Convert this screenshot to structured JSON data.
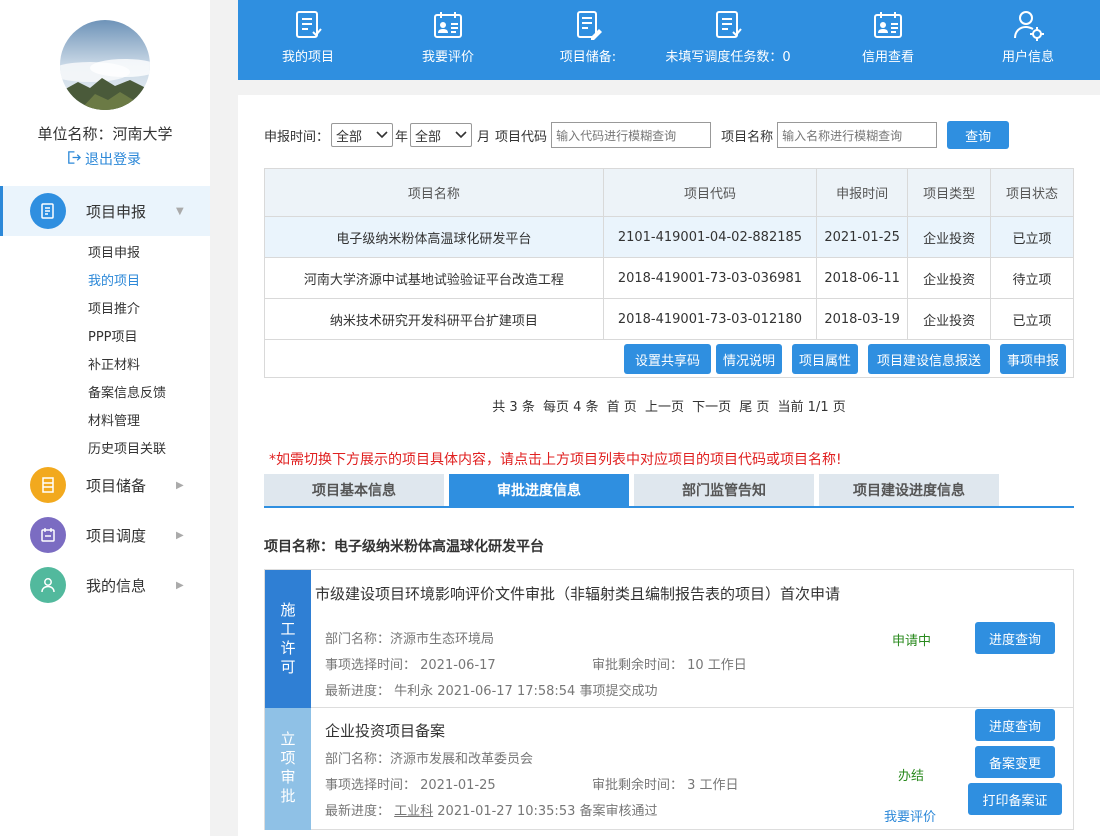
{
  "sidebar": {
    "unit_name": "单位名称：河南大学",
    "logout": "退出登录",
    "nav": [
      {
        "label": "项目申报",
        "icon": "document-icon",
        "color": "#2f8fe0"
      },
      {
        "label": "项目储备",
        "icon": "storage-icon",
        "color": "#f2a91e"
      },
      {
        "label": "项目调度",
        "icon": "schedule-icon",
        "color": "#7b6cc2"
      },
      {
        "label": "我的信息",
        "icon": "user-icon",
        "color": "#52b99d"
      }
    ],
    "sub_items": [
      "项目申报",
      "我的项目",
      "项目推介",
      "PPP项目",
      "补正材料",
      "备案信息反馈",
      "材料管理",
      "历史项目关联"
    ]
  },
  "topbar": {
    "items": [
      {
        "label": "我的项目",
        "icon": "list-icon"
      },
      {
        "label": "我要评价",
        "icon": "calendar-user-icon"
      },
      {
        "label": "项目储备:",
        "icon": "document-edit-icon"
      },
      {
        "label": "未填写调度任务数：0",
        "icon": "checklist-icon"
      },
      {
        "label": "信用查看",
        "icon": "credit-card-icon"
      },
      {
        "label": "用户信息",
        "icon": "user-settings-icon"
      }
    ]
  },
  "search": {
    "time_label": "申报时间：",
    "year_value": "全部",
    "year_unit": "年",
    "month_value": "全部",
    "month_unit": "月",
    "code_label": "项目代码",
    "code_placeholder": "输入代码进行模糊查询",
    "name_label": "项目名称",
    "name_placeholder": "输入名称进行模糊查询",
    "query_button": "查询"
  },
  "table": {
    "headers": [
      "项目名称",
      "项目代码",
      "申报时间",
      "项目类型",
      "项目状态"
    ],
    "rows": [
      [
        "电子级纳米粉体高温球化研发平台",
        "2101-419001-04-02-882185",
        "2021-01-25",
        "企业投资",
        "已立项"
      ],
      [
        "河南大学济源中试基地试验验证平台改造工程",
        "2018-419001-73-03-036981",
        "2018-06-11",
        "企业投资",
        "待立项"
      ],
      [
        "纳米技术研究开发科研平台扩建项目",
        "2018-419001-73-03-012180",
        "2018-03-19",
        "企业投资",
        "已立项"
      ]
    ],
    "actions": [
      "设置共享码",
      "情况说明",
      "项目属性",
      "项目建设信息报送",
      "事项申报"
    ]
  },
  "pager": {
    "total": "共 3 条",
    "per_page": "每页 4 条",
    "first": "首 页",
    "prev": "上一页",
    "next": "下一页",
    "last": "尾 页",
    "current": "当前 1/1 页"
  },
  "warning": "*如需切换下方展示的项目具体内容，请点击上方项目列表中对应项目的项目代码或项目名称!",
  "tabs": [
    "项目基本信息",
    "审批进度信息",
    "部门监管告知",
    "项目建设进度信息"
  ],
  "project_name": "项目名称：电子级纳米粉体高温球化研发平台",
  "stages": [
    {
      "label": "施工许可",
      "color": "#2f7fd4",
      "title": "市级建设项目环境影响评价文件审批（非辐射类且编制报告表的项目）首次申请",
      "dept": "部门名称：济源市生态环境局",
      "select_time": "事项选择时间：  2021-06-17",
      "remaining": "审批剩余时间：  10 工作日",
      "progress": "最新进度：  牛利永 2021-06-17 17:58:54  事项提交成功",
      "status": "申请中",
      "buttons": [
        "进度查询"
      ]
    },
    {
      "label": "立项审批",
      "color": "#8fc1e6",
      "title": "企业投资项目备案",
      "dept": "部门名称：济源市发展和改革委员会",
      "select_time": "事项选择时间：  2021-01-25",
      "remaining": "审批剩余时间：  3 工作日",
      "progress_prefix": "最新进度：  ",
      "progress_name": "工业科",
      "progress_rest": " 2021-01-27 10:35:53 备案审核通过",
      "status": "办结",
      "evaluate": "我要评价",
      "buttons": [
        "进度查询",
        "备案变更",
        "打印备案证"
      ]
    }
  ]
}
